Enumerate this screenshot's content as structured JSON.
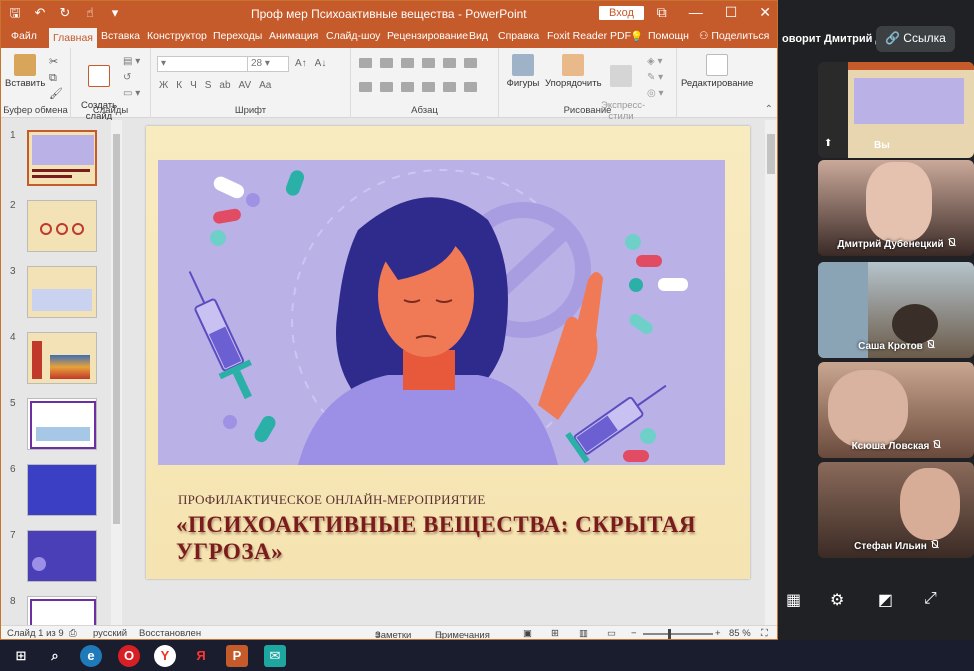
{
  "window": {
    "title": "Проф мер Психоактивные вещества  -  PowerPoint",
    "signin": "Вход",
    "controls": [
      "⧉",
      "—",
      "☐",
      "✕"
    ]
  },
  "ribbon_tabs": [
    "Файл",
    "Главная",
    "Вставка",
    "Конструктор",
    "Переходы",
    "Анимация",
    "Слайд-шоу",
    "Рецензирование",
    "Вид",
    "Справка",
    "Foxit Reader PDF",
    "Помощн",
    "Поделиться"
  ],
  "ribbon": {
    "clipboard": {
      "label": "Буфер обмена",
      "paste": "Вставить"
    },
    "slides": {
      "label": "Слайды",
      "create": "Создать\nслайд"
    },
    "font": {
      "label": "Шрифт",
      "size": "28",
      "tools": [
        "Ж",
        "К",
        "Ч",
        "S",
        "ab",
        "AV",
        "Aa"
      ]
    },
    "paragraph": {
      "label": "Абзац"
    },
    "drawing": {
      "label": "Рисование",
      "shapes": "Фигуры",
      "arrange": "Упорядочить",
      "styles": "Экспресс-\nстили"
    },
    "editing": {
      "label": "Редактирование"
    }
  },
  "thumbnails": [
    {
      "num": "1",
      "selected": true
    },
    {
      "num": "2"
    },
    {
      "num": "3"
    },
    {
      "num": "4"
    },
    {
      "num": "5"
    },
    {
      "num": "6"
    },
    {
      "num": "7"
    },
    {
      "num": "8"
    }
  ],
  "slide": {
    "subtitle": "ПРОФИЛАКТИЧЕСКОЕ ОНЛАЙН-МЕРОПРИЯТИЕ",
    "title": "«ПСИХОАКТИВНЫЕ ВЕЩЕСТВА: СКРЫТАЯ УГРОЗА»"
  },
  "status": {
    "slide_counter": "Слайд 1 из 9",
    "language": "русский",
    "state": "Восстановлен",
    "notes": "Заметки",
    "comments": "Примечания",
    "zoom": "85 %"
  },
  "call": {
    "speaker": "оворит Дмитрий Д.",
    "link_button": "Ссылка",
    "self_label": "Вы",
    "participants": [
      {
        "name": "Дмитрий Дубенецкий"
      },
      {
        "name": "Саша Кротов"
      },
      {
        "name": "Ксюша Ловская"
      },
      {
        "name": "Стефан Ильин"
      }
    ]
  },
  "colors": {
    "accent": "#c55a2b",
    "slide_title": "#7a1c1c",
    "illustration_bg": "#bab1e7"
  }
}
